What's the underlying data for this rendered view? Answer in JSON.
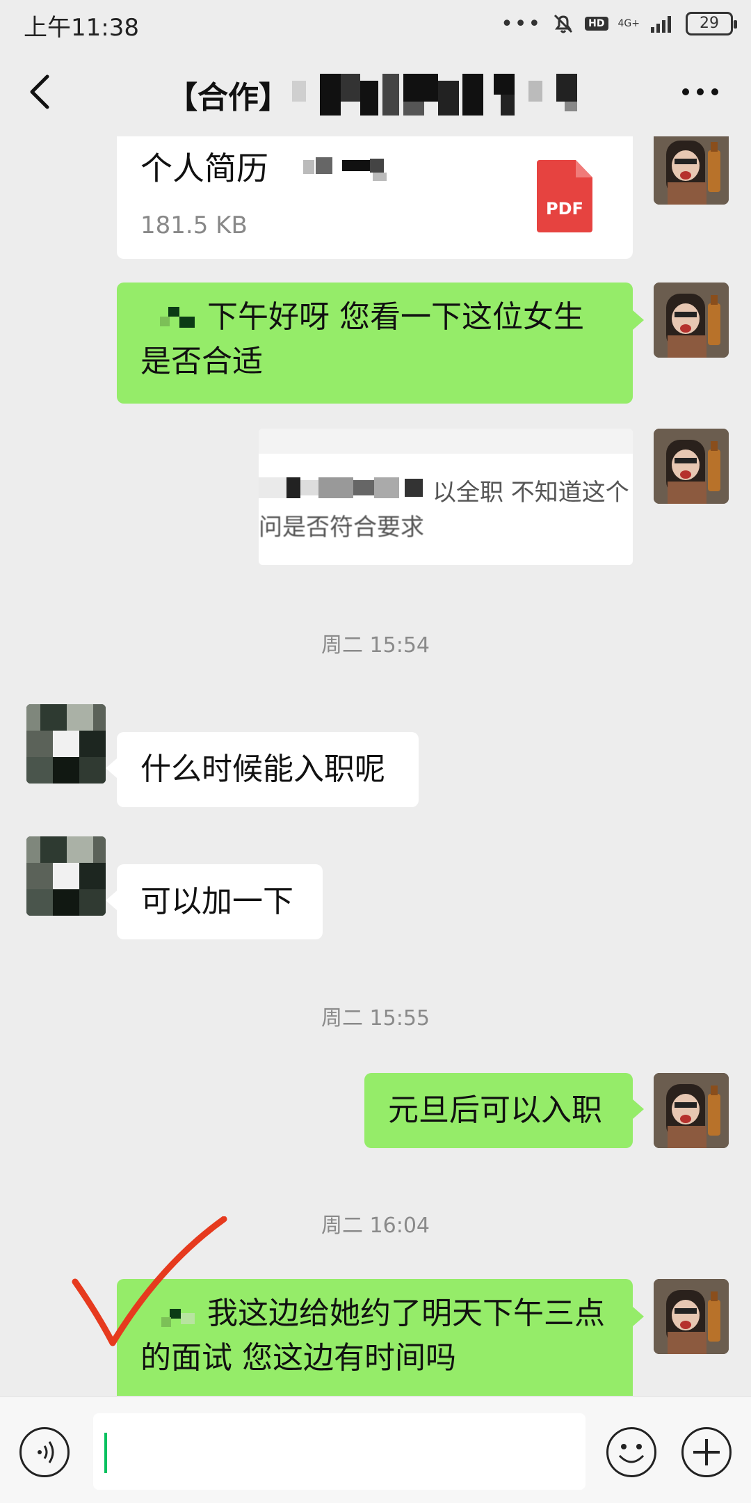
{
  "status_bar": {
    "time": "上午11:38",
    "dots": "•••",
    "hd": "HD",
    "network": "4G+",
    "battery": "29"
  },
  "nav": {
    "title": "【合作】"
  },
  "messages": {
    "file": {
      "name": "个人简历",
      "size": "181.5 KB",
      "icon_label": "PDF"
    },
    "msg1": "下午好呀 您看一下这位女生是否合适",
    "quote_line1": "以全职 不知道这个",
    "quote_line2": "问是否符合要求",
    "time1": "周二 15:54",
    "msg2": "什么时候能入职呢",
    "msg3": "可以加一下",
    "time2": "周二 15:55",
    "msg4": "元旦后可以入职",
    "time3": "周二 16:04",
    "msg5": "我这边给她约了明天下午三点的面试 您这边有时间吗"
  },
  "colors": {
    "bubble_green": "#95ec69",
    "background": "#ededed",
    "pdf_red": "#e64340",
    "annotation_red": "#e63a1e"
  }
}
